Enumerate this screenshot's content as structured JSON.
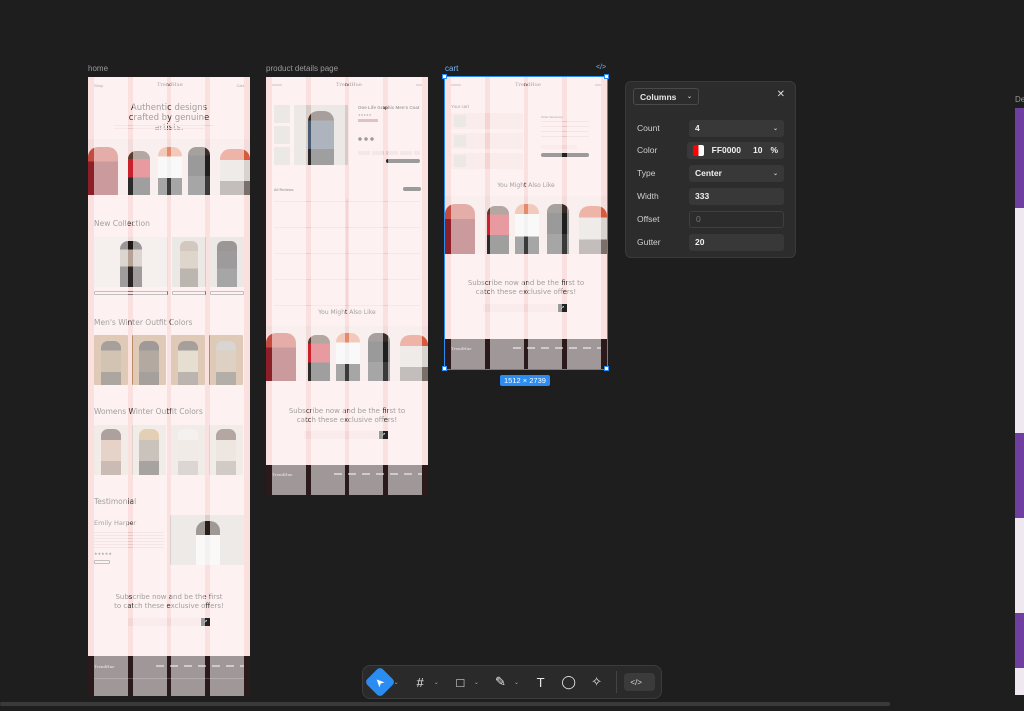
{
  "frames": {
    "home": {
      "label": "home",
      "brand": "TrendHue",
      "nav_left": "Shop",
      "nav_right": "Cart",
      "hero_title": "Authentic designs crafted by genuine artists.",
      "new_collection": "New Collection",
      "mens_title": "Men's Winter Outfit Colors",
      "womens_title": "Womens Winter Outfit Colors",
      "testimonial_title": "Testimonial",
      "testimonial_name": "Emily Harper",
      "subscribe_text": "Subscribe now and be the first to catch these exclusive offers!",
      "subscribe_arrow": "↗",
      "footer_brand": "TrendHue"
    },
    "product": {
      "label": "product details page",
      "brand": "TrendHue",
      "product_name": "One Life Graphic Men's Coat",
      "reviews_title": "All Reviews",
      "also_like": "You Might Also Like",
      "subscribe_text": "Subscribe now and be the first to catch these exclusive offers!",
      "subscribe_arrow": "↗",
      "footer_brand": "TrendHue"
    },
    "cart": {
      "label": "cart",
      "brand": "TrendHue",
      "your_cart": "Your cart",
      "order_summary": "Order Summary",
      "also_like": "You Might Also Like",
      "subscribe_text": "Subscribe now and be the first to catch these exclusive offers!",
      "subscribe_arrow": "↗",
      "footer_brand": "TrendHue",
      "dims": "1512 × 2739",
      "code_icon": "</>"
    },
    "partial": {
      "label": "De"
    }
  },
  "columns_panel": {
    "title": "Columns",
    "count_label": "Count",
    "count_value": "4",
    "color_label": "Color",
    "color_hex": "FF0000",
    "color_opacity": "10",
    "color_unit": "%",
    "type_label": "Type",
    "type_value": "Center",
    "width_label": "Width",
    "width_value": "333",
    "offset_label": "Offset",
    "offset_value": "0",
    "gutter_label": "Gutter",
    "gutter_value": "20",
    "close": "✕",
    "swatch_color": "#ff0000"
  },
  "toolbar": {
    "move_icon": "➤",
    "frame_icon": "#",
    "rect_icon": "□",
    "pen_icon": "✎",
    "text_icon": "T",
    "comment_icon": "◯",
    "ai_icon": "✧",
    "code_label": "</>",
    "accent": "#2b8cf2"
  }
}
